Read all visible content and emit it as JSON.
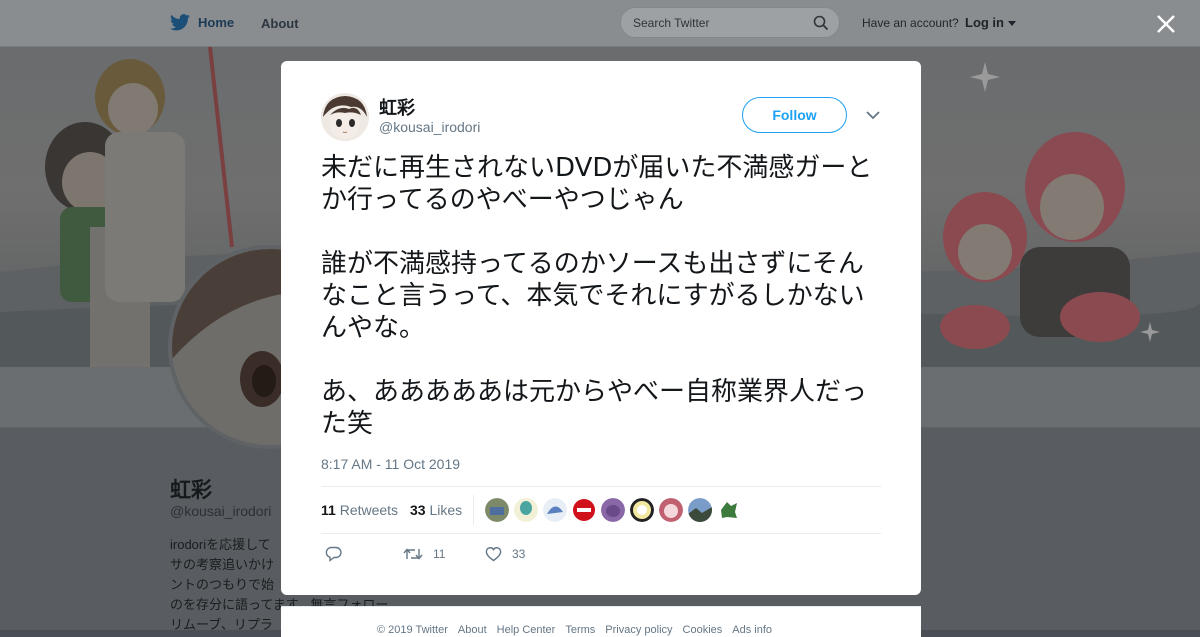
{
  "topbar": {
    "home_label": "Home",
    "about_label": "About",
    "search_placeholder": "Search Twitter",
    "account_prompt": "Have an account?",
    "login_label": "Log in"
  },
  "profile": {
    "name": "虹彩",
    "handle": "@kousai_irodori",
    "bio": "irodoriを応援して\nサの考察追いかけ\nントのつもりで始\nのを存分に語ってます。無言フォロー\nリムーブ、リプラ"
  },
  "tweet": {
    "display_name": "虹彩",
    "handle": "@kousai_irodori",
    "follow_label": "Follow",
    "paragraphs": [
      "未だに再生されないDVDが届いた不満感ガーとか行ってるのやべーやつじゃん",
      "誰が不満感持ってるのかソースも出さずにそんなこと言うって、本気でそれにすがるしかないんやな。",
      "あ、あああああは元からやべー自称業界人だった笑"
    ],
    "timestamp": "8:17 AM - 11 Oct 2019",
    "retweets_count": "11",
    "retweets_label": "Retweets",
    "likes_count": "33",
    "likes_label": "Likes",
    "action_retweet_count": "11",
    "action_like_count": "33"
  },
  "footer": {
    "links": [
      "© 2019 Twitter",
      "About",
      "Help Center",
      "Terms",
      "Privacy policy",
      "Cookies",
      "Ads info"
    ]
  },
  "colors": {
    "accent": "#1da1f2",
    "text": "#14171a",
    "muted": "#657786"
  },
  "icons": [
    "twitter-bird-icon",
    "search-icon",
    "close-icon",
    "chevron-down-icon",
    "reply-icon",
    "retweet-icon",
    "heart-icon"
  ]
}
